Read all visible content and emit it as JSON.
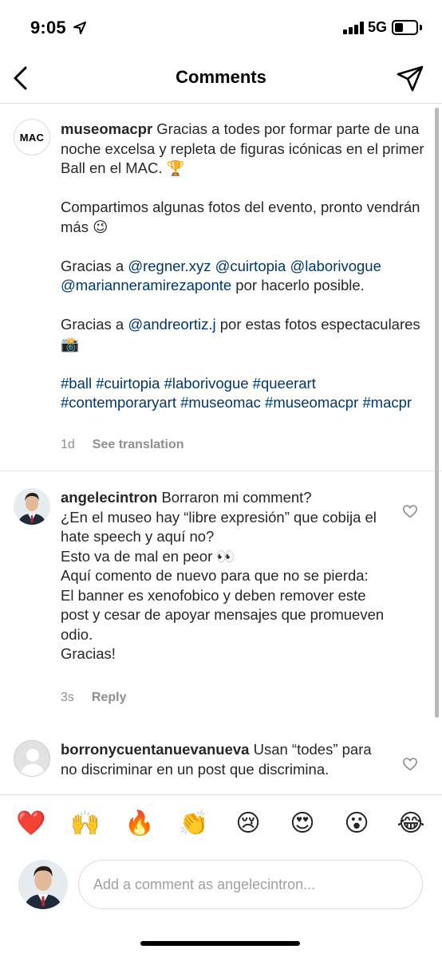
{
  "status_bar": {
    "time": "9:05",
    "network": "5G"
  },
  "header": {
    "title": "Comments",
    "back_icon": "chevron-left-icon",
    "send_icon": "paper-plane-icon"
  },
  "caption": {
    "avatar_text": "MAC",
    "username": "museomacpr",
    "line1": "Gracias a todes por formar parte de una noche excelsa y repleta de figuras icónicas en el primer Ball en el MAC. 🏆",
    "line2": "Compartimos algunas fotos del evento, pronto vendrán más 😉",
    "thanks_prefix": "Gracias a ",
    "mention_1": "@regner.xyz",
    "mention_2": "@cuirtopia",
    "mention_3": "@laborivogue",
    "mention_4": "@marianneramirezaponte",
    "thanks_suffix": " por hacerlo posible.",
    "photo_prefix": "Gracias a ",
    "photo_mention": "@andreortiz.j",
    "photo_suffix": " por estas fotos espectaculares 📸",
    "hashtags": "#ball #cuirtopia #laborivogue #queerart #contemporaryart #museomac #museomacpr #macpr",
    "time": "1d",
    "see_translation": "See translation"
  },
  "comments": [
    {
      "username": "angelecintron",
      "text_1": "Borraron mi comment?",
      "text_2": "¿En el museo hay “libre expresión” que cobija el hate speech y aquí no?",
      "text_3": "Esto va de mal en peor 👀",
      "text_4": "Aquí comento de nuevo para que no se pierda:",
      "text_5": "El banner es xenofobico y deben remover este post y cesar de apoyar mensajes que promueven odio.",
      "text_6": "Gracias!",
      "time": "3s",
      "reply": "Reply"
    },
    {
      "username": "borronycuentanuevanueva",
      "text_1": "Usan “todes” para no discriminar en un post que discrimina."
    }
  ],
  "reactions": [
    "❤️",
    "🙌",
    "🔥",
    "👏",
    "😢",
    "😍",
    "😮",
    "😂"
  ],
  "input": {
    "placeholder": "Add a comment as angelecintron..."
  }
}
